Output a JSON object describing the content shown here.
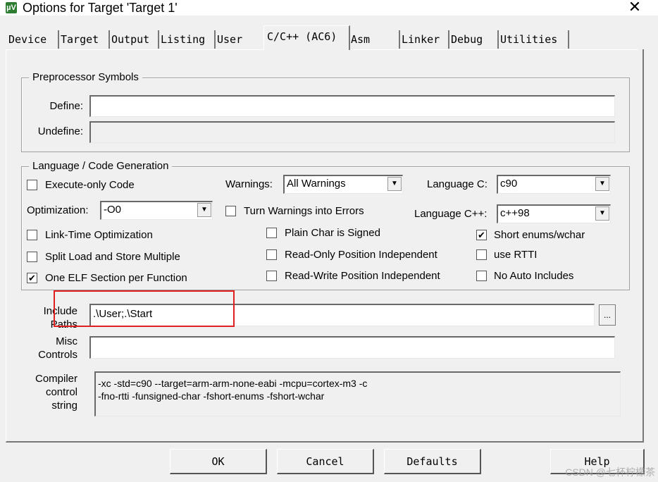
{
  "window": {
    "title": "Options for Target 'Target 1'",
    "close_symbol": "✕",
    "icon_text": "µV"
  },
  "tabs": [
    {
      "label": "Device",
      "active": false
    },
    {
      "label": "Target",
      "active": false
    },
    {
      "label": "Output",
      "active": false
    },
    {
      "label": "Listing",
      "active": false
    },
    {
      "label": "User",
      "active": false
    },
    {
      "label": "C/C++ (AC6)",
      "active": true
    },
    {
      "label": "Asm",
      "active": false
    },
    {
      "label": "Linker",
      "active": false
    },
    {
      "label": "Debug",
      "active": false
    },
    {
      "label": "Utilities",
      "active": false
    }
  ],
  "preprocessor": {
    "legend": "Preprocessor Symbols",
    "define_label": "Define:",
    "define_value": "",
    "undefine_label": "Undefine:",
    "undefine_value": ""
  },
  "codegen": {
    "legend": "Language / Code Generation",
    "execute_only": {
      "label": "Execute-only Code",
      "checked": false
    },
    "warnings_label": "Warnings:",
    "warnings_value": "All Warnings",
    "language_c_label": "Language C:",
    "language_c_value": "c90",
    "optimization_label": "Optimization:",
    "optimization_value": "-O0",
    "turn_warnings": {
      "label": "Turn Warnings into Errors",
      "checked": false
    },
    "language_cpp_label": "Language C++:",
    "language_cpp_value": "c++98",
    "link_time": {
      "label": "Link-Time Optimization",
      "checked": false
    },
    "plain_char": {
      "label": "Plain Char is Signed",
      "checked": false
    },
    "short_enums": {
      "label": "Short enums/wchar",
      "checked": true
    },
    "split_load": {
      "label": "Split Load and Store Multiple",
      "checked": false
    },
    "read_only_pi": {
      "label": "Read-Only Position Independent",
      "checked": false
    },
    "use_rtti": {
      "label": "use RTTI",
      "checked": false
    },
    "one_elf": {
      "label": "One ELF Section per Function",
      "checked": true
    },
    "read_write_pi": {
      "label": "Read-Write Position Independent",
      "checked": false
    },
    "no_auto_includes": {
      "label": "No Auto Includes",
      "checked": false
    }
  },
  "include": {
    "label_line1": "Include",
    "label_line2": "Paths",
    "value": ".\\User;.\\Start",
    "browse_label": "..."
  },
  "misc": {
    "label_line1": "Misc",
    "label_line2": "Controls",
    "value": ""
  },
  "compiler": {
    "label_line1": "Compiler",
    "label_line2": "control",
    "label_line3": "string",
    "line1": "-xc -std=c90 --target=arm-arm-none-eabi -mcpu=cortex-m3 -c",
    "line2": "-fno-rtti -funsigned-char -fshort-enums -fshort-wchar"
  },
  "buttons": {
    "ok": "OK",
    "cancel": "Cancel",
    "defaults": "Defaults",
    "help": "Help"
  },
  "watermark": "CSDN @七杯柠檬茶",
  "colors": {
    "highlight": "#e02020",
    "check_mark": "#000000"
  }
}
